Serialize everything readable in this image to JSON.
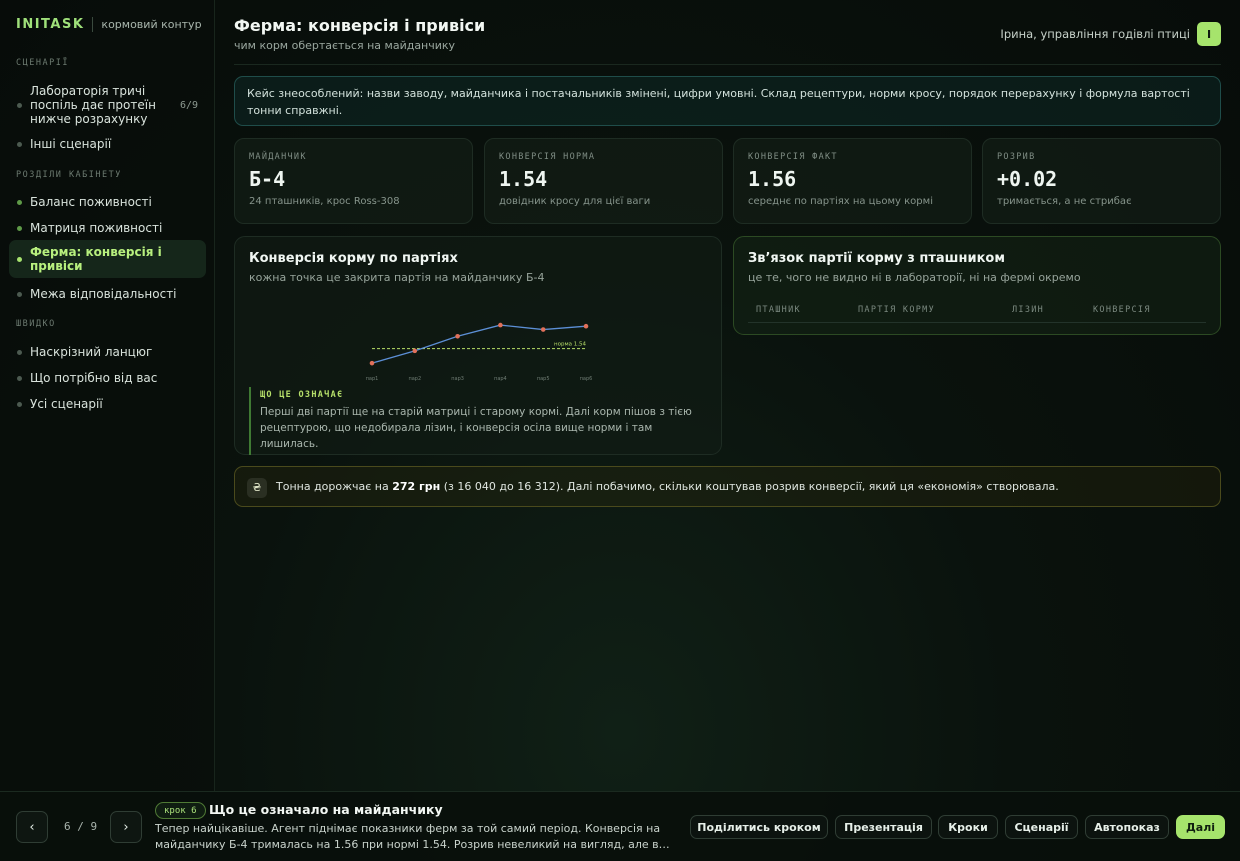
{
  "brand": {
    "name": "INITASK",
    "subtitle": "кормовий контур"
  },
  "sidebar": {
    "sections": [
      {
        "label": "СЦЕНАРІЇ"
      },
      {
        "label": "РОЗДІЛИ КАБІНЕТУ"
      },
      {
        "label": "ШВИДКО"
      }
    ],
    "scenario_items": [
      {
        "label": "Лабораторія тричі поспіль дає протеїн нижче розрахунку",
        "count": "6/9"
      },
      {
        "label": "Інші сценарії"
      }
    ],
    "cabinet_items": [
      {
        "label": "Баланс поживності"
      },
      {
        "label": "Матриця поживності"
      },
      {
        "label": "Ферма: конверсія і привіси"
      },
      {
        "label": "Межа відповідальності"
      }
    ],
    "quick_items": [
      {
        "label": "Наскрізний ланцюг"
      },
      {
        "label": "Що потрібно від вас"
      },
      {
        "label": "Усі сценарії"
      }
    ]
  },
  "header": {
    "title": "Ферма: конверсія і привіси",
    "subtitle": "чим корм обертається на майданчику",
    "user": "Ірина, управління годівлі птиці",
    "avatar": "І"
  },
  "notice": "Кейс знеособлений: назви заводу, майданчика і постачальників змінені, цифри умовні. Склад рецептури, норми кросу, порядок перерахунку і формула вартості тонни справжні.",
  "kpis": [
    {
      "label": "МАЙДАНЧИК",
      "value": "Б-4",
      "note": "24 пташників, крос Ross-308"
    },
    {
      "label": "КОНВЕРСІЯ НОРМА",
      "value": "1.54",
      "note": "довідник кросу для цієї ваги"
    },
    {
      "label": "КОНВЕРСІЯ ФАКТ",
      "value": "1.56",
      "note": "середнє по партіях на цьому кормі"
    },
    {
      "label": "РОЗРИВ",
      "value": "+0.02",
      "note": "тримається, а не стрибає"
    }
  ],
  "chart_panel": {
    "title": "Конверсія корму по партіях",
    "subtitle": "кожна точка це закрита партія на майданчику Б-4",
    "meaning_label": "ЩО ЦЕ ОЗНАЧАЄ",
    "meaning_text": "Перші дві партії ще на старій матриці і старому кормі. Далі корм пішов з тією рецептурою, що недобирала лізин, і конверсія осіла вище норми і там лишилась."
  },
  "chart_data": {
    "type": "line",
    "categories": [
      "пар1",
      "пар2",
      "пар3",
      "пар4",
      "пар5",
      "пар6"
    ],
    "values": [
      1.527,
      1.538,
      1.551,
      1.561,
      1.557,
      1.56
    ],
    "reference_line": {
      "label": "норма 1.54",
      "value": 1.54
    },
    "ylim": [
      1.52,
      1.57
    ],
    "grid": false,
    "line_color": "#5c8fd6",
    "point_color": "#e0705a",
    "reference_color": "#b9e06a"
  },
  "link_panel": {
    "title": "Зв’язок партії корму з пташником",
    "subtitle": "це те, чого не видно ні в лабораторії, ні на фермі окремо",
    "columns": [
      "ПТАШНИК",
      "ПАРТІЯ КОРМУ",
      "ЛІЗИН",
      "КОНВЕРСІЯ"
    ]
  },
  "cost": {
    "icon": "₴",
    "prefix": "Тонна дорожчає на ",
    "amount": "272 грн",
    "suffix": " (з 16 040 до 16 312). Далі побачимо, скільки коштував розрив конверсії, який ця «економія» створювала."
  },
  "footer": {
    "prev": "‹",
    "next": "›",
    "pager": "6 / 9",
    "step_badge": "крок 6",
    "step_title": "Що це означало на майданчику",
    "step_text": "Тепер найцікавіше. Агент піднімає показники ферм за той самий період. Конверсія на майданчику Б-4 трималась на 1.56 при нормі 1.54. Розрив невеликий на вигляд, але він тримається стабільно, партія за партією.",
    "actions": [
      "Поділитись кроком",
      "Презентація",
      "Кроки",
      "Сценарії",
      "Автопоказ",
      "Далі"
    ]
  },
  "colors": {
    "accent": "#a6e46c",
    "notice_border": "#1f4d4a",
    "cost_border": "#4a4a1c"
  }
}
